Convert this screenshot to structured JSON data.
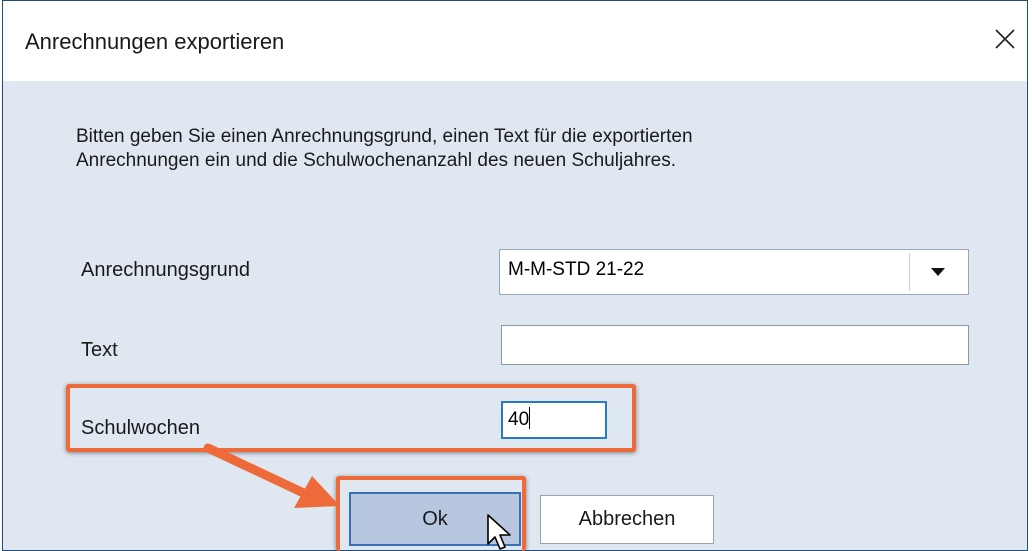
{
  "dialog": {
    "title": "Anrechnungen exportieren",
    "close_icon": "close-icon",
    "instructions_line1": "Bitten geben Sie einen Anrechnungsgrund, einen Text für die exportierten",
    "instructions_line2": "Anrechnungen ein und die Schulwochenanzahl des neuen Schuljahres."
  },
  "form": {
    "reason_label": "Anrechnungsgrund",
    "reason_value": "M-M-STD 21-22",
    "text_label": "Text",
    "text_value": "",
    "weeks_label": "Schulwochen",
    "weeks_value": "40"
  },
  "buttons": {
    "ok_label": "Ok",
    "cancel_label": "Abbrechen"
  },
  "annotations": {
    "highlight_color": "#ef6a3a",
    "arrow_icon": "arrow-icon",
    "cursor_icon": "mouse-pointer-icon"
  }
}
